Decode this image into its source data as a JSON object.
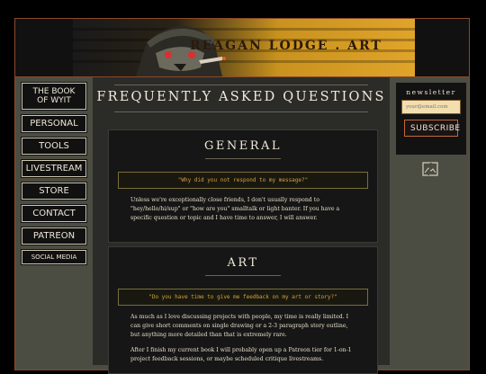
{
  "banner": {
    "site_title": "REAGAN LODGE . ART"
  },
  "nav": {
    "items": [
      {
        "label_line1": "THE BOOK",
        "label_line2": "OF WYIT"
      },
      {
        "label": "PERSONAL"
      },
      {
        "label": "TOOLS"
      },
      {
        "label": "LIVESTREAM"
      },
      {
        "label": "STORE"
      },
      {
        "label": "CONTACT"
      },
      {
        "label": "PATREON"
      },
      {
        "label": "SOCIAL MEDIA"
      }
    ]
  },
  "main": {
    "page_title": "FREQUENTLY ASKED QUESTIONS",
    "sections": [
      {
        "title": "GENERAL",
        "question": "\"Why did you not respond to my message?\"",
        "answer": [
          "Unless we're exceptionally close friends, I don't usually respond to \"hey/hello/hi/sup\" or \"how are you\" smalltalk or light banter. If you have a specific question or topic and I have time to answer, I will answer."
        ]
      },
      {
        "title": "ART",
        "question": "\"Do you have time to give me feedback on my art or story?\"",
        "answer": [
          "As much as I love discussing projects with people, my time is really limited. I can give short comments on single drawing or a 2-3 paragraph story outline, but anything more detailed than that is extremely rare.",
          "After I finish my current book I will probably open up a Patreon tier for 1-on-1 project feedback sessions, or maybe scheduled critique livestreams."
        ]
      }
    ]
  },
  "newsletter": {
    "label": "newsletter",
    "email_placeholder": "your@email.com",
    "subscribe_label": "SUBSCRIBE"
  },
  "colors": {
    "frame_border": "#8a4a2a",
    "question_text": "#d4a23a",
    "banner_gold": "#e0a42a"
  }
}
